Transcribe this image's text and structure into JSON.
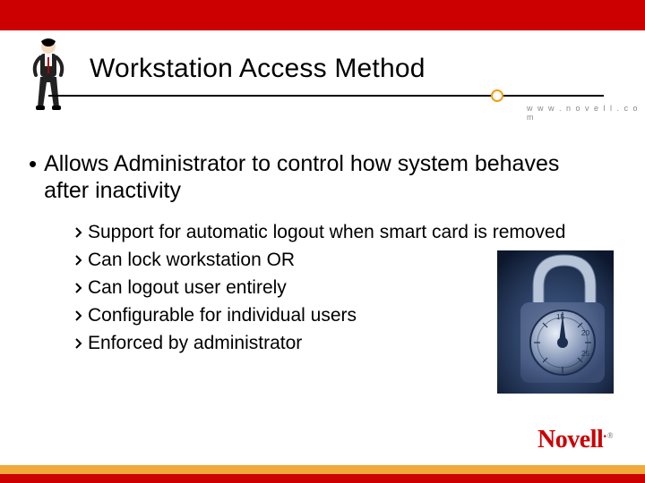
{
  "slide": {
    "title": "Workstation Access Method",
    "website": "w w w . n o v e l l . c o m",
    "main_bullet": "Allows Administrator to control how system behaves after inactivity",
    "sub_bullets": [
      "Support for automatic logout when smart card is removed",
      "Can lock workstation OR",
      "Can logout user entirely",
      "Configurable for individual users",
      "Enforced by administrator"
    ],
    "logo_text": "Novell",
    "logo_tag": "®"
  },
  "colors": {
    "brand_red": "#CC0000",
    "accent_orange": "#F2A93B"
  }
}
